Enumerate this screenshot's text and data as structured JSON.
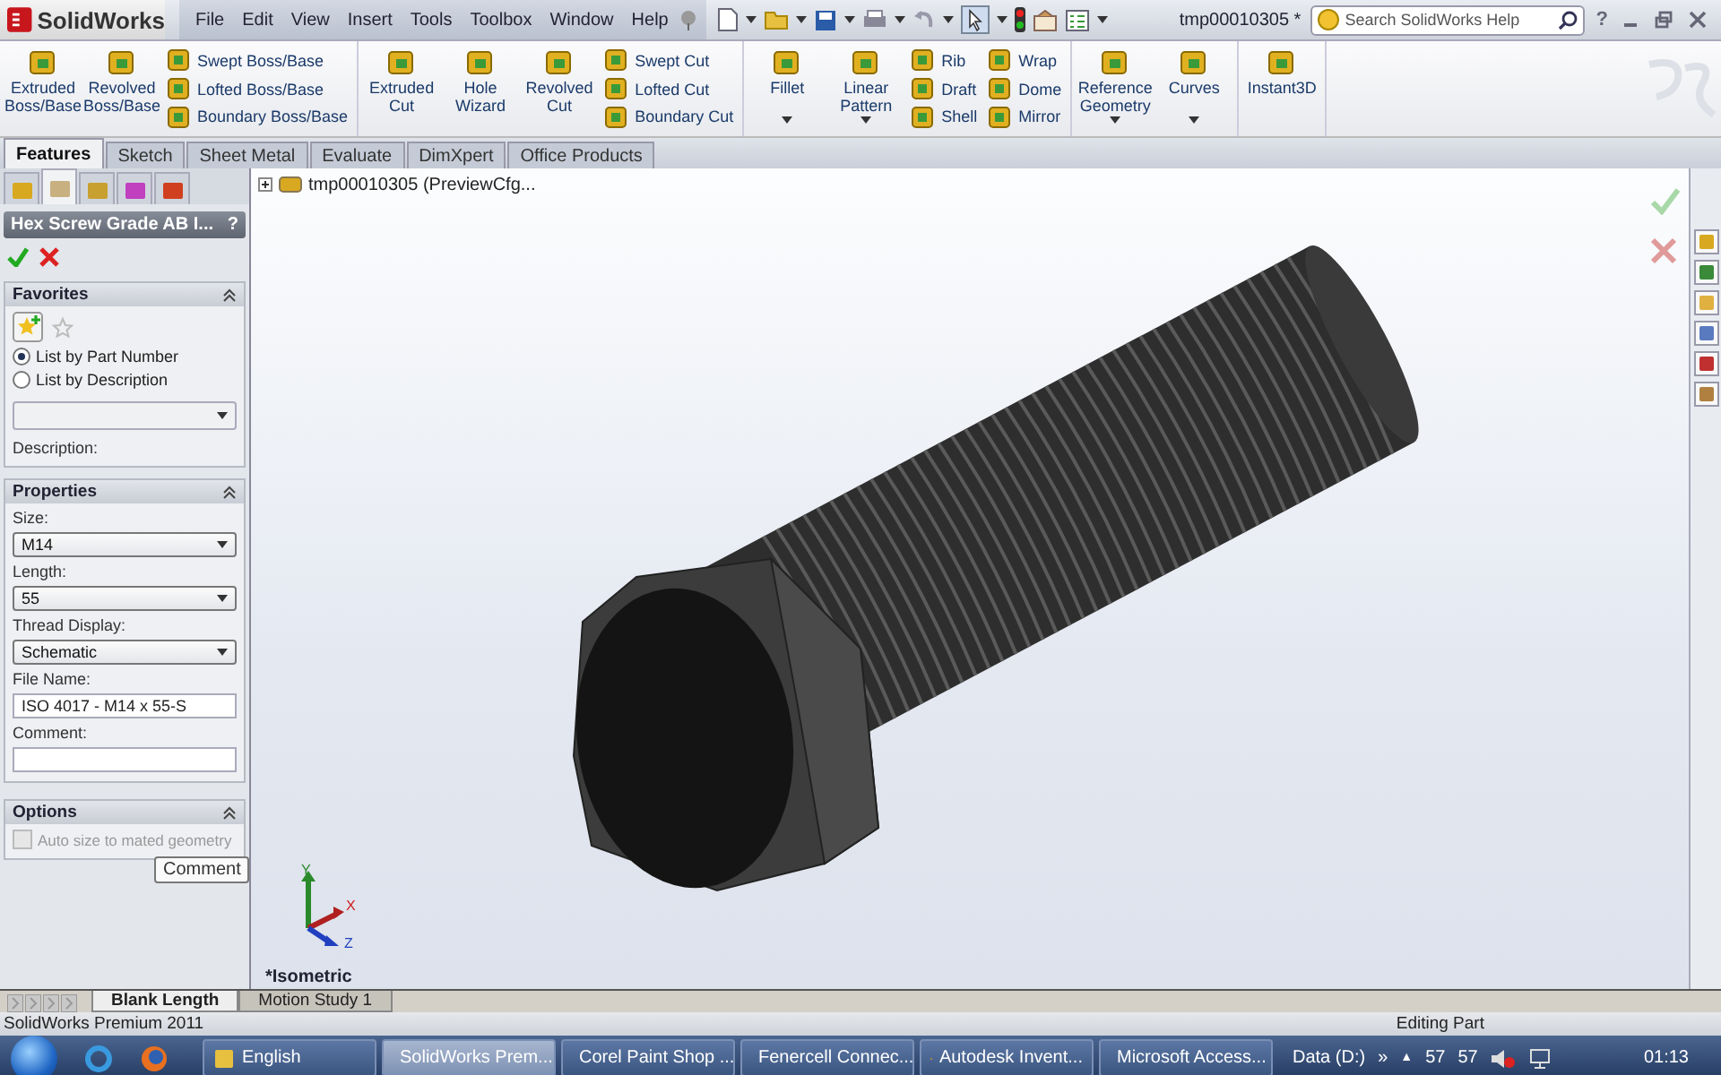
{
  "app": {
    "logo": "SolidWorks",
    "menu": [
      "File",
      "Edit",
      "View",
      "Insert",
      "Tools",
      "Toolbox",
      "Window",
      "Help"
    ],
    "document_title": "tmp00010305 *",
    "search": {
      "placeholder": "Search SolidWorks Help"
    },
    "help": "?"
  },
  "ribbon": [
    {
      "blocks": [
        {
          "kind": "large",
          "label": "Extruded Boss/Base",
          "dropdown": false
        },
        {
          "kind": "large",
          "label": "Revolved Boss/Base",
          "dropdown": false
        },
        {
          "kind": "stack",
          "items": [
            "Swept Boss/Base",
            "Lofted Boss/Base",
            "Boundary Boss/Base"
          ]
        }
      ]
    },
    {
      "blocks": [
        {
          "kind": "large",
          "label": "Extruded Cut",
          "dropdown": false
        },
        {
          "kind": "large",
          "label": "Hole Wizard",
          "dropdown": false
        },
        {
          "kind": "large",
          "label": "Revolved Cut",
          "dropdown": false
        },
        {
          "kind": "stack",
          "items": [
            "Swept Cut",
            "Lofted Cut",
            "Boundary Cut"
          ]
        }
      ]
    },
    {
      "blocks": [
        {
          "kind": "large",
          "label": "Fillet",
          "dropdown": true
        },
        {
          "kind": "large",
          "label": "Linear Pattern",
          "dropdown": true
        },
        {
          "kind": "stack",
          "items": [
            "Rib",
            "Draft",
            "Shell"
          ]
        },
        {
          "kind": "stack",
          "items": [
            "Wrap",
            "Dome",
            "Mirror"
          ]
        }
      ]
    },
    {
      "blocks": [
        {
          "kind": "large",
          "label": "Reference Geometry",
          "dropdown": true
        },
        {
          "kind": "large",
          "label": "Curves",
          "dropdown": true
        }
      ]
    },
    {
      "blocks": [
        {
          "kind": "large",
          "label": "Instant3D",
          "dropdown": false
        }
      ]
    }
  ],
  "command_tabs": [
    {
      "label": "Features",
      "selected": true
    },
    {
      "label": "Sketch",
      "selected": false
    },
    {
      "label": "Sheet Metal",
      "selected": false
    },
    {
      "label": "Evaluate",
      "selected": false
    },
    {
      "label": "DimXpert",
      "selected": false
    },
    {
      "label": "Office Products",
      "selected": false
    }
  ],
  "manager_tabs": [
    {
      "selected": false
    },
    {
      "selected": true
    },
    {
      "selected": false
    },
    {
      "selected": false
    },
    {
      "selected": false
    }
  ],
  "property_manager": {
    "title": "Hex Screw Grade AB I...",
    "help": "?",
    "favorites": {
      "title": "Favorites",
      "options": [
        {
          "label": "List by Part Number",
          "selected": true
        },
        {
          "label": "List by Description",
          "selected": false
        }
      ],
      "description_label": "Description:"
    },
    "properties": {
      "title": "Properties",
      "fields": [
        {
          "kind": "dropdown",
          "label": "Size:",
          "value": "M14"
        },
        {
          "kind": "dropdown",
          "label": "Length:",
          "value": "55"
        },
        {
          "kind": "dropdown",
          "label": "Thread Display:",
          "value": "Schematic"
        },
        {
          "kind": "text",
          "label": "File Name:",
          "value": "ISO 4017 - M14 x 55-S"
        },
        {
          "kind": "text",
          "label": "Comment:"
        }
      ]
    },
    "tooltip": "Comment",
    "options": {
      "title": "Options",
      "checkbox": {
        "label": "Auto size to mated geometry",
        "checked": false,
        "disabled": true
      }
    }
  },
  "viewport": {
    "tree_item": "tmp00010305  (PreviewCfg...",
    "view_name": "*Isometric",
    "triad": {
      "x": "X",
      "y": "Y",
      "z": "Z"
    }
  },
  "bottom_tabs": [
    {
      "label": "Blank Length",
      "selected": true
    },
    {
      "label": "Motion Study 1",
      "selected": false
    }
  ],
  "status_bar": {
    "product": "SolidWorks Premium 2011",
    "mode": "Editing Part"
  },
  "taskbar": {
    "apps": [
      {
        "label": "English",
        "selected": false
      },
      {
        "label": "SolidWorks Prem...",
        "selected": true
      },
      {
        "label": "Corel Paint Shop ...",
        "selected": false
      },
      {
        "label": "Fenercell Connec...",
        "selected": false
      },
      {
        "label": "Autodesk Invent...",
        "selected": false
      },
      {
        "label": "Microsoft Access...",
        "selected": false
      }
    ],
    "tray": {
      "drive": "Data (D:)",
      "more": "»",
      "expand": "▲",
      "readings": [
        "57",
        "57"
      ],
      "clock": "01:13"
    }
  }
}
